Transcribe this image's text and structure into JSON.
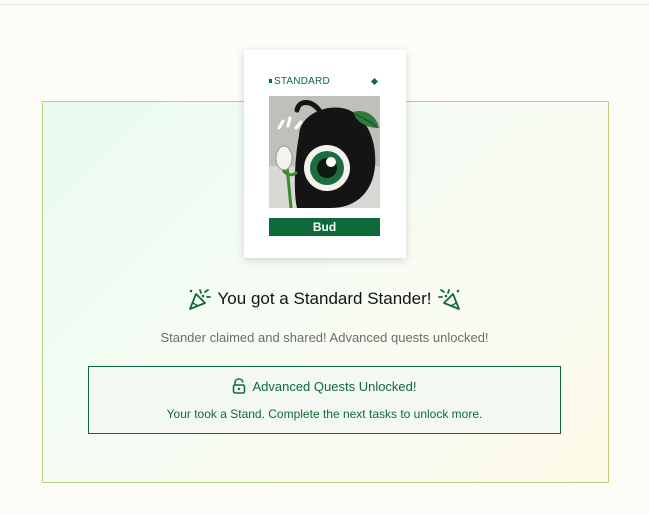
{
  "card": {
    "tier": "STANDARD",
    "name": "Bud"
  },
  "headline": "You got a Standard Stander!",
  "subtitle": "Stander claimed and shared! Advanced quests unlocked!",
  "unlock": {
    "title": "Advanced Quests Unlocked!",
    "description": "Your took a Stand. Complete the next tasks to unlock more."
  },
  "colors": {
    "accent": "#0f6a3a",
    "panel_border": "#b9d27f",
    "page_bg": "#fdfcf7"
  },
  "icons": {
    "celebration_left": "party-popper-icon",
    "celebration_right": "party-popper-icon",
    "unlock": "unlock-icon"
  }
}
